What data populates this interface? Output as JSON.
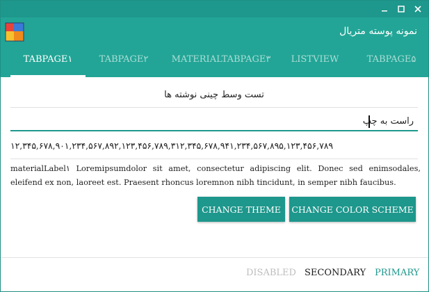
{
  "window": {
    "title": "نمونه پوسته متریال",
    "controls": [
      "minimize-icon",
      "maximize-icon",
      "close-icon"
    ]
  },
  "colors": {
    "titlebar": "#1e978c",
    "primary": "#22a596",
    "accent": "#1e978c",
    "text": "#222222",
    "disabled": "#bdbdbd"
  },
  "tabs": [
    {
      "label": "TABPAGE۱",
      "active": true
    },
    {
      "label": "TABPAGE۲",
      "active": false
    },
    {
      "label": "MATERIALTABPAGE۳",
      "active": false
    },
    {
      "label": "LISTVIEW",
      "active": false
    },
    {
      "label": "TABPAGE۵",
      "active": false
    }
  ],
  "content": {
    "center_label": "تست وسط چینی نوشته ها",
    "rtl_input_value": "راست به چپ",
    "number_line": "۱۲,۳۴۵,۶۷۸,۹۰۱,۲۳۴,۵۶۷,۸۹۲,۱۲۳,۴۵۶,۷۸۹,۳۱۲,۳۴۵,۶۷۸,۹۴۱,۲۳۴,۵۶۷,۸۹۵,۱۲۳,۴۵۶,۷۸۹",
    "paragraph": "materialLabel۱ Loremipsumdolor sit amet, consectetur adipiscing elit. Donec sed enimsodales, eleifend ex non, laoreet est. Praesent rhoncus loremnon nibh tincidunt, in semper nibh faucibus."
  },
  "buttons": {
    "change_theme": "CHANGE THEME",
    "change_color_scheme": "CHANGE COLOR SCHEME"
  },
  "footer": {
    "disabled": "DISABLED",
    "secondary": "SECONDARY",
    "primary": "PRIMARY"
  }
}
